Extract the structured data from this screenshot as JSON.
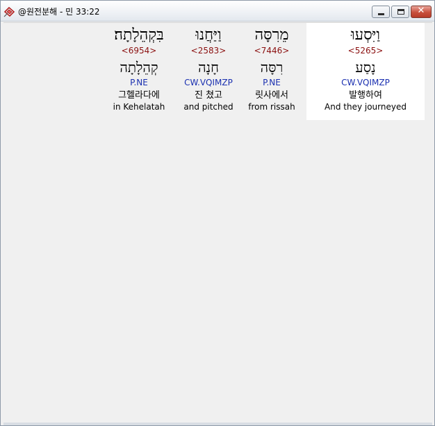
{
  "window": {
    "title": "@원전분해 - 민 33:22",
    "app_icon": "bible-book-icon",
    "controls": {
      "minimize_icon": "minimize-icon",
      "maximize_icon": "maximize-icon",
      "close_icon": "close-icon",
      "close_glyph": "✕"
    }
  },
  "verse": {
    "words": [
      {
        "form": "וַיִּסְעוּ",
        "strong": "<5265>",
        "lemma": "נָסַע",
        "morph": "CW.VQIMZP",
        "korean": "발행하여",
        "english": "And they journeyed",
        "selected": true
      },
      {
        "form": "מֵרִסָּה",
        "strong": "<7446>",
        "lemma": "רִסָּה",
        "morph": "P.NE",
        "korean": "릿사에서",
        "english": "from rissah",
        "selected": false
      },
      {
        "form": "וַיַּחֲנוּ",
        "strong": "<2583>",
        "lemma": "חָנָה",
        "morph": "CW.VQIMZP",
        "korean": "진 쳤고",
        "english": "and pitched",
        "selected": false
      },
      {
        "form": "בִּקְהֵלָתָה׃",
        "strong": "<6954>",
        "lemma": "קְהֵלָתָה",
        "morph": "P.NE",
        "korean": "그헬라다에",
        "english": "in Kehelatah",
        "selected": false
      }
    ]
  },
  "colors": {
    "strong": "#8b1010",
    "morph": "#1a2fb0",
    "selected_bg": "#ffffff",
    "client_bg": "#f0f0f0"
  }
}
